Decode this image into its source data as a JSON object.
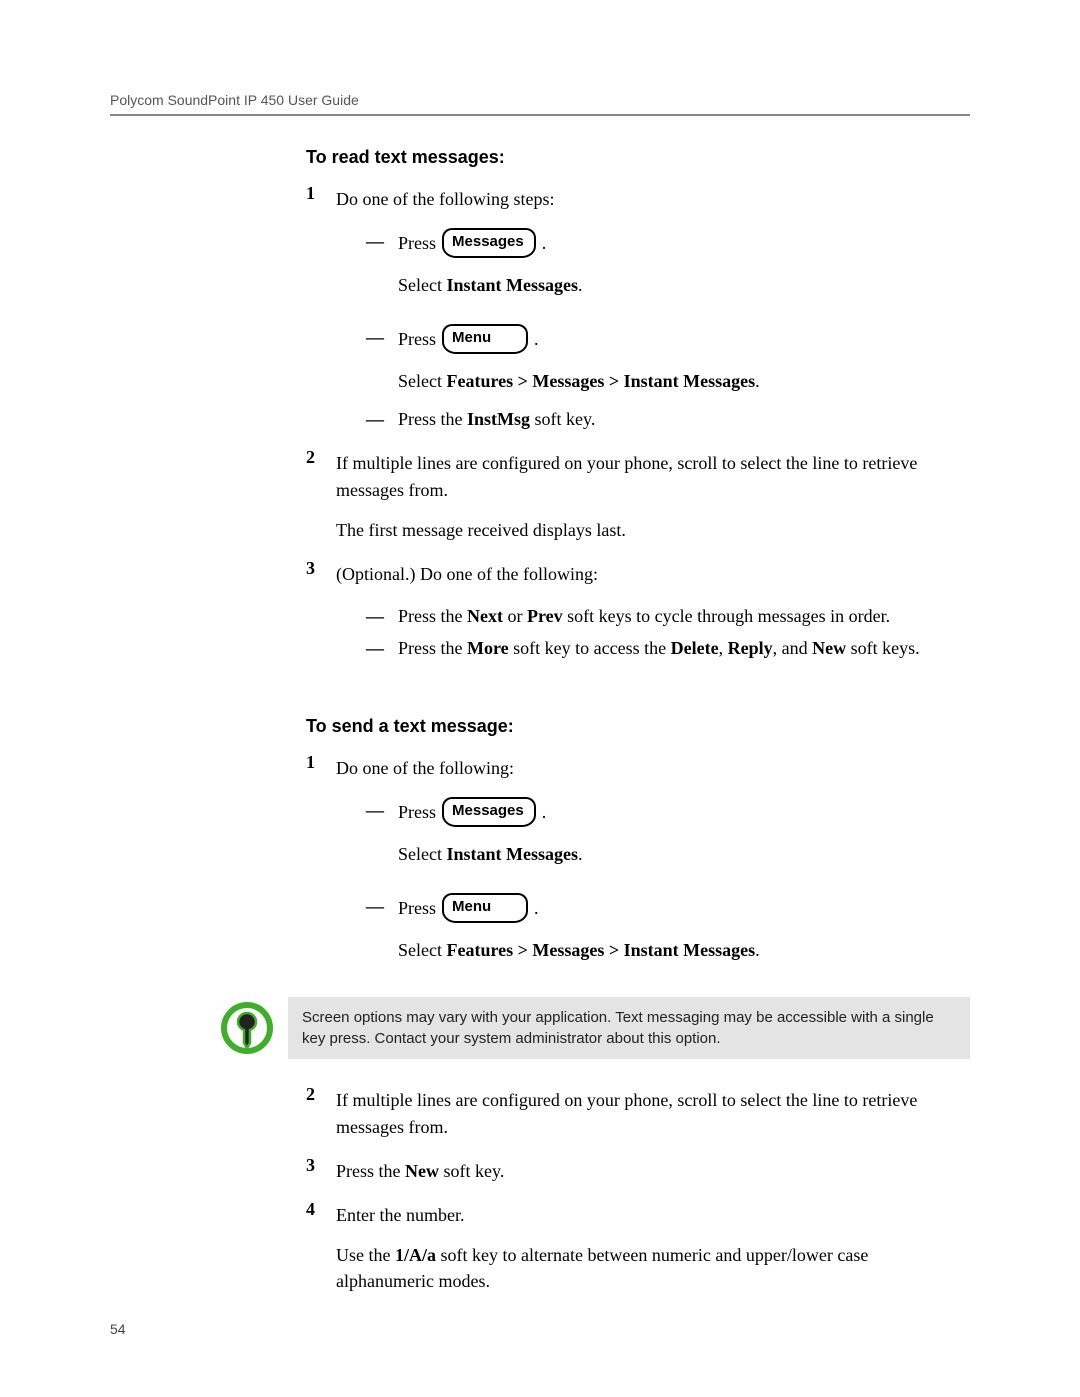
{
  "header": "Polycom SoundPoint IP 450 User Guide",
  "page_number": "54",
  "buttons": {
    "messages": "Messages",
    "menu": "Menu"
  },
  "words": {
    "press": "Press",
    "select": "Select",
    "period": "."
  },
  "read": {
    "title": "To read text messages:",
    "step1_intro": "Do one of the following steps:",
    "a_select": "Instant Messages",
    "b_select": "Features > Messages > Instant Messages",
    "c_prefix": "Press the ",
    "c_key": "InstMsg",
    "c_suffix": " soft key.",
    "step2a": "If multiple lines are configured on your phone, scroll to select the line to retrieve messages from.",
    "step2b": "The first message received displays last.",
    "step3_intro": "(Optional.) Do one of the following:",
    "s3a_p1": "Press the ",
    "s3a_b1": "Next",
    "s3a_mid": " or ",
    "s3a_b2": "Prev",
    "s3a_p2": " soft keys to cycle through messages in order.",
    "s3b_p1": "Press the ",
    "s3b_b1": "More",
    "s3b_p2": " soft key to access the ",
    "s3b_b2": "Delete",
    "s3b_c1": ", ",
    "s3b_b3": "Reply",
    "s3b_c2": ", and ",
    "s3b_b4": "New",
    "s3b_p3": " soft keys."
  },
  "send": {
    "title": "To send a text message:",
    "step1_intro": "Do one of the following:",
    "a_select": "Instant Messages",
    "b_select": "Features > Messages > Instant Messages",
    "note": "Screen options may vary with your application. Text messaging may be accessible with a single key press. Contact your system administrator about this option.",
    "step2": "If multiple lines are configured on your phone, scroll to select the line to retrieve messages from.",
    "step3_p1": "Press the ",
    "step3_b": "New",
    "step3_p2": " soft key.",
    "step4": "Enter the number.",
    "step4b_p1": "Use the ",
    "step4b_b": "1/A/a",
    "step4b_p2": " soft key to alternate between numeric and upper/lower case alphanumeric modes."
  },
  "nums": {
    "n1": "1",
    "n2": "2",
    "n3": "3",
    "n4": "4"
  }
}
